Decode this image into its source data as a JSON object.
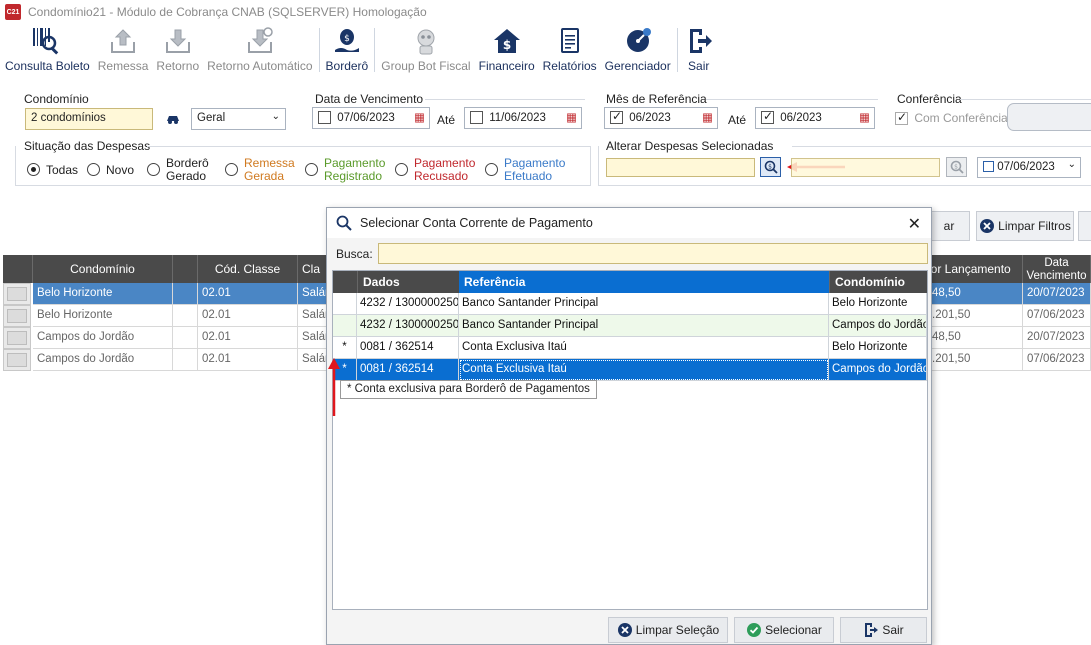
{
  "window": {
    "title": "Condomínio21 - Módulo de Cobrança CNAB (SQLSERVER)  Homologação",
    "app_icon_text": "C21"
  },
  "toolbar": {
    "items": [
      {
        "label": "Consulta Boleto"
      },
      {
        "label": "Remessa"
      },
      {
        "label": "Retorno"
      },
      {
        "label": "Retorno Automático"
      },
      {
        "label": "Borderô"
      },
      {
        "label": "Group Bot Fiscal"
      },
      {
        "label": "Financeiro"
      },
      {
        "label": "Relatórios"
      },
      {
        "label": "Gerenciador"
      },
      {
        "label": "Sair"
      }
    ]
  },
  "filters": {
    "condominio": {
      "title": "Condomínio",
      "value": "2 condomínios",
      "select": "Geral"
    },
    "vencimento": {
      "title": "Data de Vencimento",
      "from": "07/06/2023",
      "until_label": "Até",
      "to": "11/06/2023"
    },
    "mes_ref": {
      "title": "Mês de Referência",
      "from": "06/2023",
      "until_label": "Até",
      "to": "06/2023"
    },
    "conferencia": {
      "title": "Conferência",
      "checkbox_label": "Com Conferência"
    },
    "situacao": {
      "title": "Situação das Despesas",
      "options": [
        {
          "label1": "Todas",
          "label2": "",
          "color": "#222222"
        },
        {
          "label1": "Novo",
          "label2": "",
          "color": "#222222"
        },
        {
          "label1": "Borderô",
          "label2": "Gerado",
          "color": "#222222"
        },
        {
          "label1": "Remessa",
          "label2": "Gerada",
          "color": "#d07a20"
        },
        {
          "label1": "Pagamento",
          "label2": "Registrado",
          "color": "#5a9a2a"
        },
        {
          "label1": "Pagamento",
          "label2": "Recusado",
          "color": "#c0282d"
        },
        {
          "label1": "Pagamento",
          "label2": "Efetuado",
          "color": "#3a7ac8"
        }
      ]
    },
    "alterar": {
      "title": "Alterar Despesas Selecionadas",
      "date": "07/06/2023"
    },
    "buttons": {
      "partial": "ar",
      "limpar_filtros": "Limpar Filtros"
    }
  },
  "grid": {
    "headers": [
      "Condomínio",
      "Cód. Classe",
      "Cla",
      "lor Lançamento",
      "Data Vencimento"
    ],
    "rows": [
      {
        "condominio": "Belo Horizonte",
        "classe": "02.01",
        "cla": "Salár",
        "valor": "48,50",
        "venc": "20/07/2023"
      },
      {
        "condominio": "Belo Horizonte",
        "classe": "02.01",
        "cla": "Salár",
        "valor": ".201,50",
        "venc": "07/06/2023"
      },
      {
        "condominio": "Campos do Jordão",
        "classe": "02.01",
        "cla": "Salár",
        "valor": "48,50",
        "venc": "20/07/2023"
      },
      {
        "condominio": "Campos do Jordão",
        "classe": "02.01",
        "cla": "Salár",
        "valor": ".201,50",
        "venc": "07/06/2023"
      }
    ]
  },
  "modal": {
    "title": "Selecionar Conta Corrente de Pagamento",
    "search_label": "Busca:",
    "search_value": "",
    "headers": {
      "dados": "Dados",
      "referencia": "Referência",
      "condominio": "Condomínio"
    },
    "rows": [
      {
        "mark": "",
        "dados": "4232 / 1300000250",
        "referencia": "Banco Santander Principal",
        "condominio": "Belo Horizonte"
      },
      {
        "mark": "",
        "dados": "4232 / 1300000250",
        "referencia": "Banco Santander Principal",
        "condominio": "Campos do Jordão"
      },
      {
        "mark": "*",
        "dados": "0081 / 362514",
        "referencia": "Conta Exclusiva Itaú",
        "condominio": "Belo Horizonte"
      },
      {
        "mark": "*",
        "dados": "0081 / 362514",
        "referencia": "Conta Exclusiva Itaú",
        "condominio": "Campos do Jordão"
      }
    ],
    "tooltip": "* Conta exclusiva para Borderô de Pagamentos",
    "buttons": {
      "limpar": "Limpar Seleção",
      "selecionar": "Selecionar",
      "sair": "Sair"
    }
  }
}
